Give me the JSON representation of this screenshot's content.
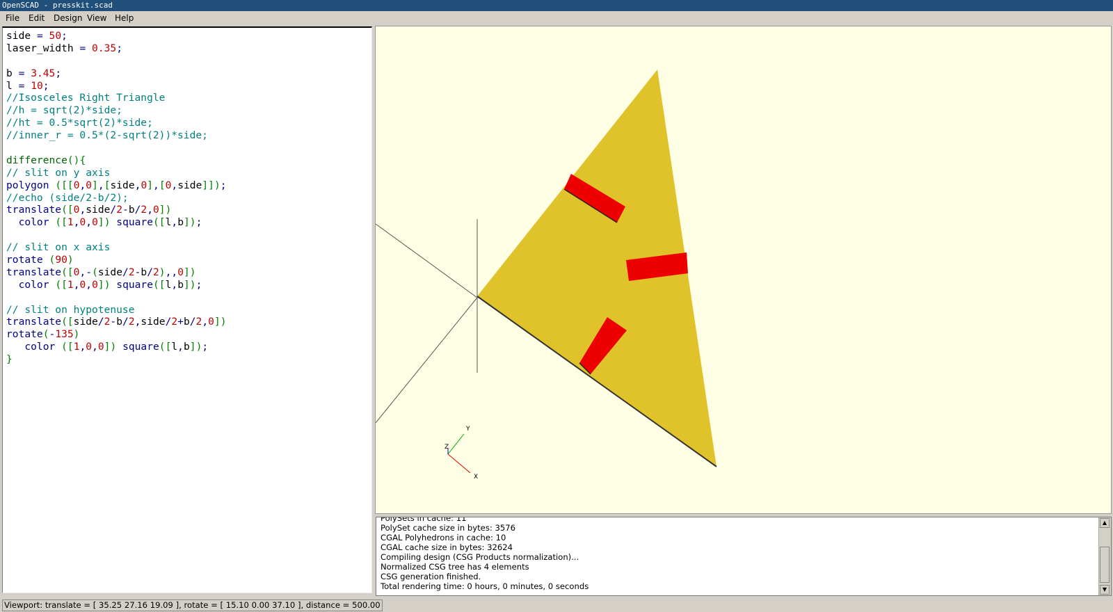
{
  "window": {
    "title": "OpenSCAD - presskit.scad"
  },
  "menu": {
    "items": [
      {
        "label": "File",
        "name": "menu-file"
      },
      {
        "label": "Edit",
        "name": "menu-edit"
      },
      {
        "label": "Design",
        "name": "menu-design"
      },
      {
        "label": "View",
        "name": "menu-view"
      },
      {
        "label": "Help",
        "name": "menu-help"
      }
    ]
  },
  "editor": {
    "lines": [
      "side = 50;",
      "laser_width = 0.35;",
      "",
      "b = 3.45;",
      "l = 10;",
      "//Isosceles Right Triangle",
      "//h = sqrt(2)*side;",
      "//ht = 0.5*sqrt(2)*side;",
      "//inner_r = 0.5*(2-sqrt(2))*side;",
      "",
      "difference(){",
      "// slit on y axis",
      "polygon ([[0,0],[side,0],[0,side]]);",
      "//echo (side/2-b/2);",
      "translate([0,side/2-b/2,0])",
      "  color ([1,0,0]) square([l,b]);",
      "",
      "// slit on x axis",
      "rotate (90)",
      "translate([0,-(side/2-b/2),,0])",
      "  color ([1,0,0]) square([l,b]);",
      "",
      "// slit on hypotenuse",
      "translate([side/2-b/2,side/2+b/2,0])",
      "rotate(-135)",
      "   color ([1,0,0]) square([l,b]);",
      "}"
    ]
  },
  "viewport": {
    "axis_labels": {
      "x": "X",
      "y": "Y",
      "z": "Z"
    },
    "colors": {
      "background": "#ffffe5",
      "triangle": "#e0c22a",
      "slit": "#ee0000",
      "axes": "#333333"
    }
  },
  "console": {
    "lines": [
      "PolySets in cache: 11",
      "PolySet cache size in bytes: 3576",
      "CGAL Polyhedrons in cache: 10",
      "CGAL cache size in bytes: 32624",
      "Compiling design (CSG Products normalization)...",
      "Normalized CSG tree has 4 elements",
      "CSG generation finished.",
      "Total rendering time: 0 hours, 0 minutes, 0 seconds"
    ]
  },
  "status": {
    "text": "Viewport: translate = [ 35.25 27.16 19.09 ], rotate = [ 15.10 0.00 37.10 ], distance = 500.00"
  },
  "icons": {
    "scroll_up": "scroll-up-arrow-icon",
    "scroll_down": "scroll-down-arrow-icon"
  }
}
